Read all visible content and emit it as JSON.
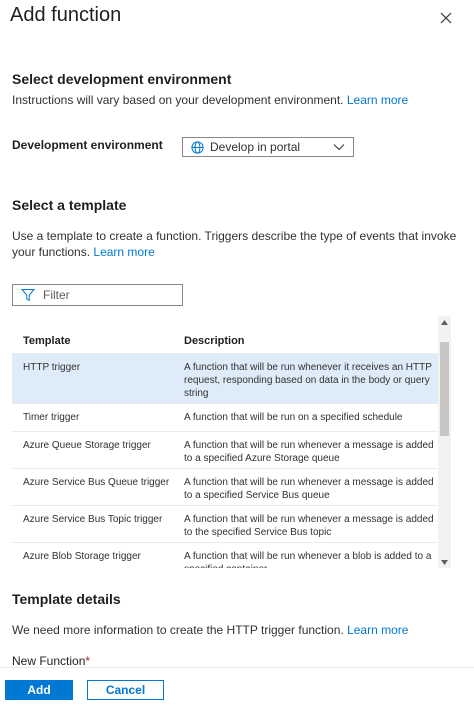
{
  "panel": {
    "title": "Add function",
    "close_icon": "close-icon"
  },
  "environment": {
    "heading": "Select development environment",
    "description": "Instructions will vary based on your development environment.",
    "learn_more": "Learn more",
    "field_label": "Development environment",
    "selected": "Develop in portal",
    "icons": [
      "globe-icon",
      "chevron-down-icon"
    ]
  },
  "template": {
    "heading": "Select a template",
    "description": "Use a template to create a function. Triggers describe the type of events that invoke your functions.",
    "learn_more": "Learn more",
    "filter_placeholder": "Filter",
    "filter_icon": "filter-icon",
    "columns": [
      "Template",
      "Description"
    ],
    "rows": [
      {
        "template": "HTTP trigger",
        "description": "A function that will be run whenever it receives an HTTP request, responding based on data in the body or query string",
        "selected": true
      },
      {
        "template": "Timer trigger",
        "description": "A function that will be run on a specified schedule",
        "selected": false
      },
      {
        "template": "Azure Queue Storage trigger",
        "description": "A function that will be run whenever a message is added to a specified Azure Storage queue",
        "selected": false
      },
      {
        "template": "Azure Service Bus Queue trigger",
        "description": "A function that will be run whenever a message is added to a specified Service Bus queue",
        "selected": false
      },
      {
        "template": "Azure Service Bus Topic trigger",
        "description": "A function that will be run whenever a message is added to the specified Service Bus topic",
        "selected": false
      },
      {
        "template": "Azure Blob Storage trigger",
        "description": "A function that will be run whenever a blob is added to a specified container",
        "selected": false
      }
    ]
  },
  "details": {
    "heading": "Template details",
    "description": "We need more information to create the HTTP trigger function.",
    "learn_more": "Learn more",
    "new_function_label": "New Function",
    "required_mark": "*"
  },
  "footer": {
    "add_label": "Add",
    "cancel_label": "Cancel"
  },
  "colors": {
    "accent": "#0078d4",
    "selected_row": "#deecf9",
    "required": "#a4262c"
  }
}
